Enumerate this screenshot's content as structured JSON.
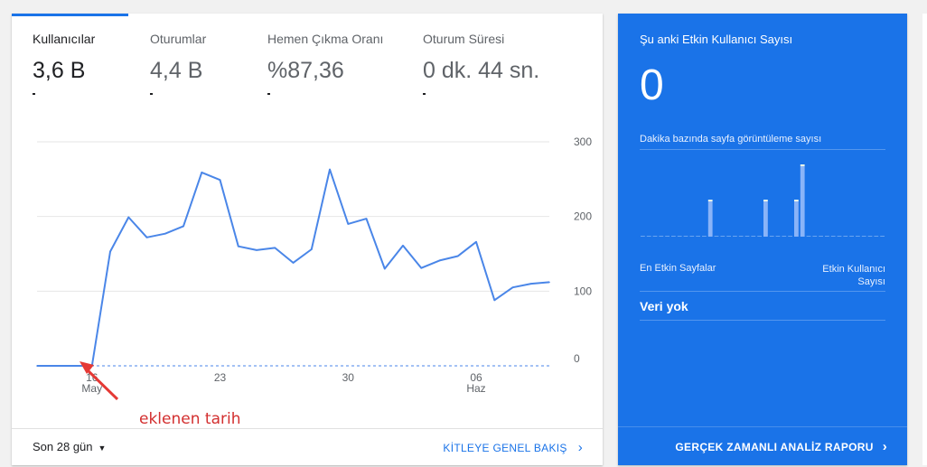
{
  "metrics": [
    {
      "label": "Kullanıcılar",
      "value": "3,6 B"
    },
    {
      "label": "Oturumlar",
      "value": "4,4 B"
    },
    {
      "label": "Hemen Çıkma Oranı",
      "value": "%87,36"
    },
    {
      "label": "Oturum Süresi",
      "value": "0 dk. 44 sn."
    }
  ],
  "chart_data": {
    "type": "line",
    "x_ticks": [
      {
        "label": "16",
        "sub": "May",
        "day_index": 3
      },
      {
        "label": "23",
        "sub": "",
        "day_index": 10
      },
      {
        "label": "30",
        "sub": "",
        "day_index": 17
      },
      {
        "label": "06",
        "sub": "Haz",
        "day_index": 24
      }
    ],
    "y_ticks": [
      0,
      100,
      200,
      300
    ],
    "ylim": [
      0,
      300
    ],
    "series": [
      {
        "values": [
          0,
          0,
          0,
          0,
          153,
          199,
          172,
          177,
          187,
          259,
          249,
          160,
          155,
          158,
          138,
          156,
          263,
          190,
          197,
          130,
          161,
          131,
          141,
          147,
          166,
          88,
          105,
          110,
          112
        ]
      }
    ],
    "comparison_baseline": 0,
    "grid": true
  },
  "footer": {
    "range_label": "Son 28 gün",
    "link_label": "KİTLEYE GENEL BAKIŞ"
  },
  "realtime": {
    "title": "Şu anki Etkin Kullanıcı Sayısı",
    "value": "0",
    "subtitle": "Dakika bazında sayfa görüntüleme sayısı",
    "bars": [
      0,
      0,
      0,
      0,
      0,
      0,
      0,
      0,
      0,
      0,
      0,
      1,
      0,
      0,
      0,
      0,
      0,
      0,
      0,
      0,
      1,
      0,
      0,
      0,
      0,
      1,
      2,
      0,
      0,
      0,
      0,
      0,
      0,
      0,
      0,
      0,
      0,
      0,
      0,
      0
    ],
    "top_pages_label": "En Etkin Sayfalar",
    "active_users_label": "Etkin Kullanıcı Sayısı",
    "empty_text": "Veri yok",
    "footer_link": "GERÇEK ZAMANLI ANALİZ RAPORU"
  },
  "annotation": {
    "text": "eklenen tarih",
    "color": "#d32f2f"
  },
  "colors": {
    "accent": "#1a73e8",
    "line": "#4a86e8",
    "realtime_bg": "#1a73e8"
  }
}
